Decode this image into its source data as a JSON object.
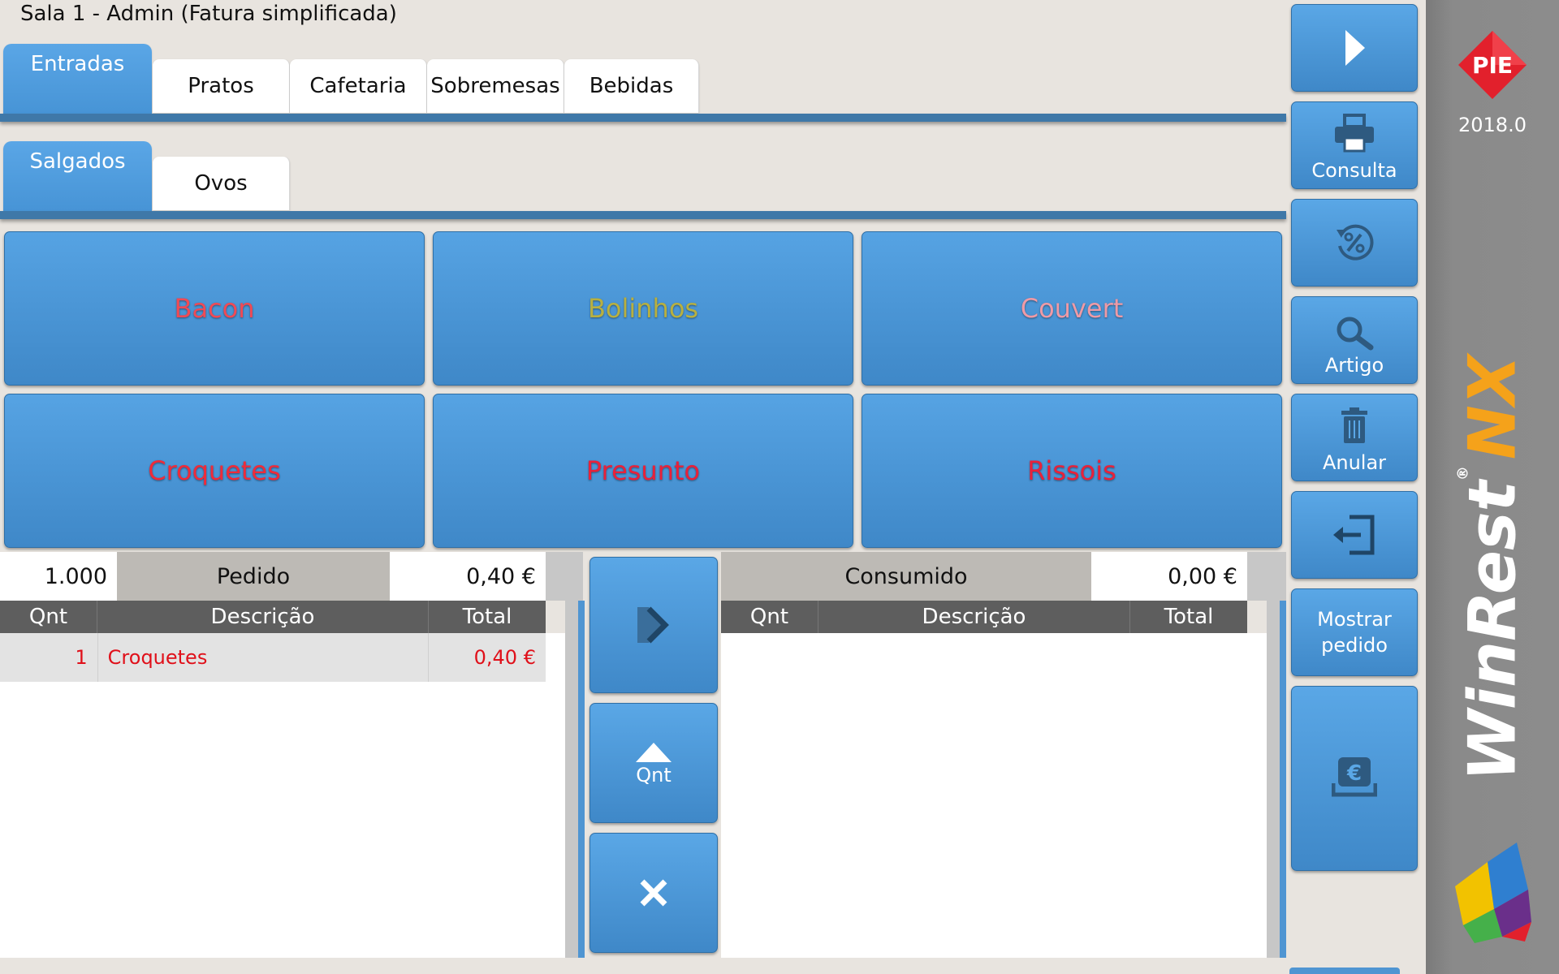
{
  "window_title": "Sala 1 - Admin (Fatura simplificada)",
  "categories": {
    "tabs": [
      "Entradas",
      "Pratos",
      "Cafetaria",
      "Sobremesas",
      "Bebidas"
    ],
    "active": "Entradas"
  },
  "subcategories": {
    "tabs": [
      "Salgados",
      "Ovos"
    ],
    "active": "Salgados"
  },
  "products": [
    {
      "label": "Bacon",
      "color": "#f04a55"
    },
    {
      "label": "Bolinhos",
      "color": "#b8b040"
    },
    {
      "label": "Couvert",
      "color": "#ee9aa6"
    },
    {
      "label": "Croquetes",
      "color": "#ef2b3a"
    },
    {
      "label": "Presunto",
      "color": "#e8213a"
    },
    {
      "label": "Rissois",
      "color": "#e8213a"
    }
  ],
  "order": {
    "quantity": "1.000",
    "label": "Pedido",
    "total": "0,40 €",
    "columns": [
      "Qnt",
      "Descrição",
      "Total"
    ],
    "rows": [
      {
        "qty": "1",
        "desc": "Croquetes",
        "total": "0,40 €"
      }
    ]
  },
  "consumed": {
    "label": "Consumido",
    "total": "0,00 €",
    "columns": [
      "Qnt",
      "Descrição",
      "Total"
    ]
  },
  "controls": {
    "transfer_icon": "double-chevron-right-icon",
    "qty_label": "Qnt",
    "cancel_icon": "close-icon"
  },
  "sidebar": {
    "next_icon": "play-arrow-icon",
    "consulta": "Consulta",
    "discount_icon": "percent-refresh-icon",
    "artigo": "Artigo",
    "anular": "Anular",
    "exit_icon": "exit-icon",
    "mostrar_pedido": "Mostrar pedido",
    "pay_icon": "euro-drawer-icon"
  },
  "brand": {
    "logo_text": "PIE",
    "version": "2018.0",
    "product_name": "WinRest",
    "product_suffix": "NX"
  },
  "colors": {
    "accent_blue": "#4794d6",
    "order_item_red": "#e0101a",
    "brand_orange": "#f5a21a",
    "logo_red": "#e2202c"
  }
}
